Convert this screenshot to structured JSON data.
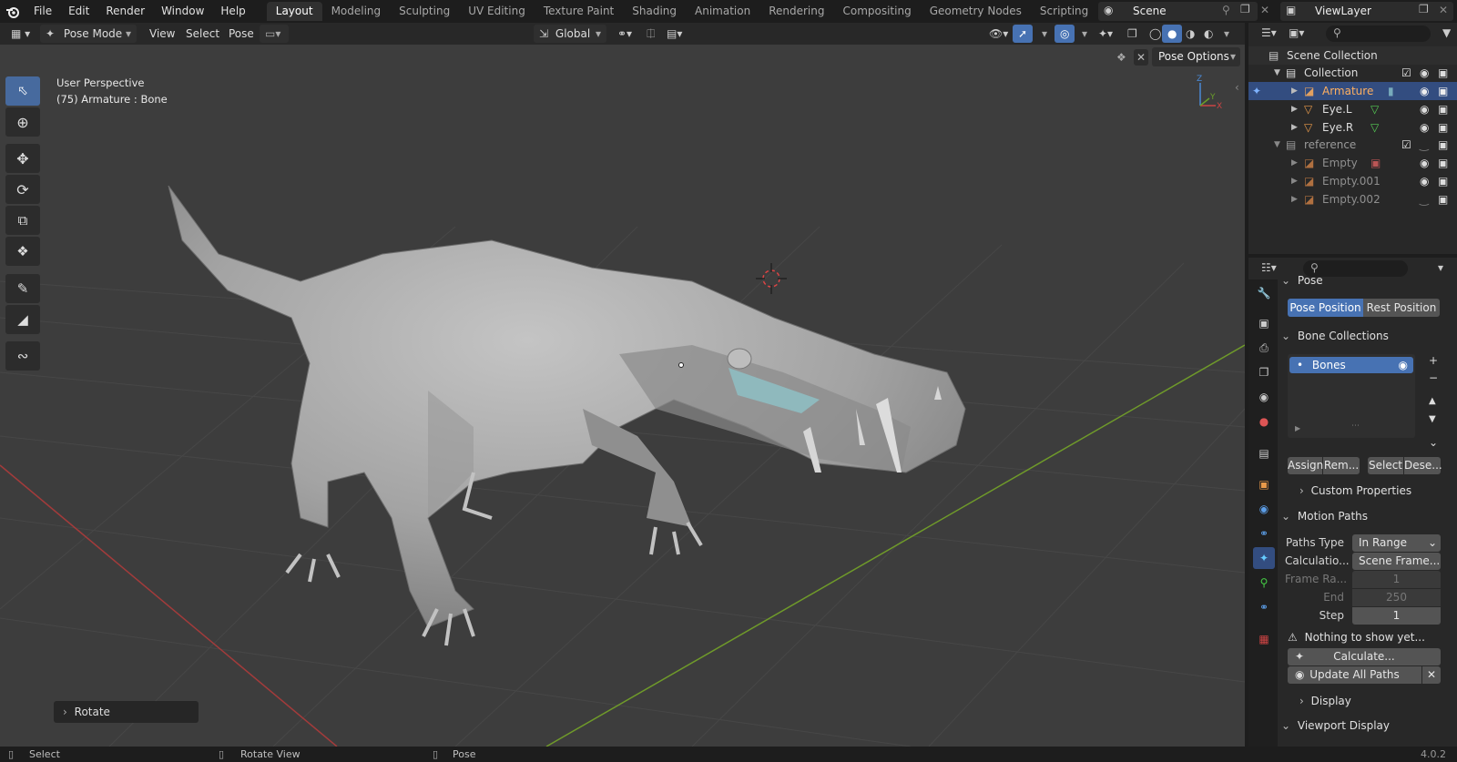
{
  "menu": [
    "File",
    "Edit",
    "Render",
    "Window",
    "Help"
  ],
  "workspaces": [
    "Layout",
    "Modeling",
    "Sculpting",
    "UV Editing",
    "Texture Paint",
    "Shading",
    "Animation",
    "Rendering",
    "Compositing",
    "Geometry Nodes",
    "Scripting"
  ],
  "active_workspace": "Layout",
  "scene": "Scene",
  "view_layer": "ViewLayer",
  "header": {
    "mode": "Pose Mode",
    "view": "View",
    "select": "Select",
    "pose": "Pose",
    "orientation": "Global",
    "pose_options": "Pose Options"
  },
  "viewport": {
    "perspective": "User Perspective",
    "object_info": "(75) Armature : Bone",
    "last_op": "Rotate"
  },
  "outliner": {
    "scene_collection": "Scene Collection",
    "items": [
      {
        "name": "Collection"
      },
      {
        "name": "Armature"
      },
      {
        "name": "Eye.L"
      },
      {
        "name": "Eye.R"
      },
      {
        "name": "reference"
      },
      {
        "name": "Empty"
      },
      {
        "name": "Empty.001"
      },
      {
        "name": "Empty.002"
      }
    ]
  },
  "properties": {
    "pose_panel": "Pose",
    "pose_position": "Pose Position",
    "rest_position": "Rest Position",
    "bone_collections": "Bone Collections",
    "bones": "Bones",
    "assign": "Assign",
    "remove": "Rem...",
    "select": "Select",
    "deselect": "Dese...",
    "custom_properties": "Custom Properties",
    "motion_paths": "Motion Paths",
    "paths_type_label": "Paths Type",
    "paths_type": "In Range",
    "calc_label": "Calculatio...",
    "calc_value": "Scene Frame...",
    "frame_range_label": "Frame Ra...",
    "frame_start": "1",
    "end_label": "End",
    "frame_end": "250",
    "step_label": "Step",
    "step": "1",
    "nothing": "Nothing to show yet...",
    "calculate": "Calculate...",
    "update_all": "Update All Paths",
    "display": "Display",
    "viewport_display": "Viewport Display"
  },
  "status": {
    "select": "Select",
    "rotate_view": "Rotate View",
    "pose": "Pose",
    "version": "4.0.2"
  },
  "colors": {
    "accent": "#4772b3",
    "selected_row": "#334d80",
    "armature": "#e0a060",
    "mesh": "#e89a4a",
    "grid_x": "#9b3a3a",
    "grid_y": "#6c8f2a"
  }
}
